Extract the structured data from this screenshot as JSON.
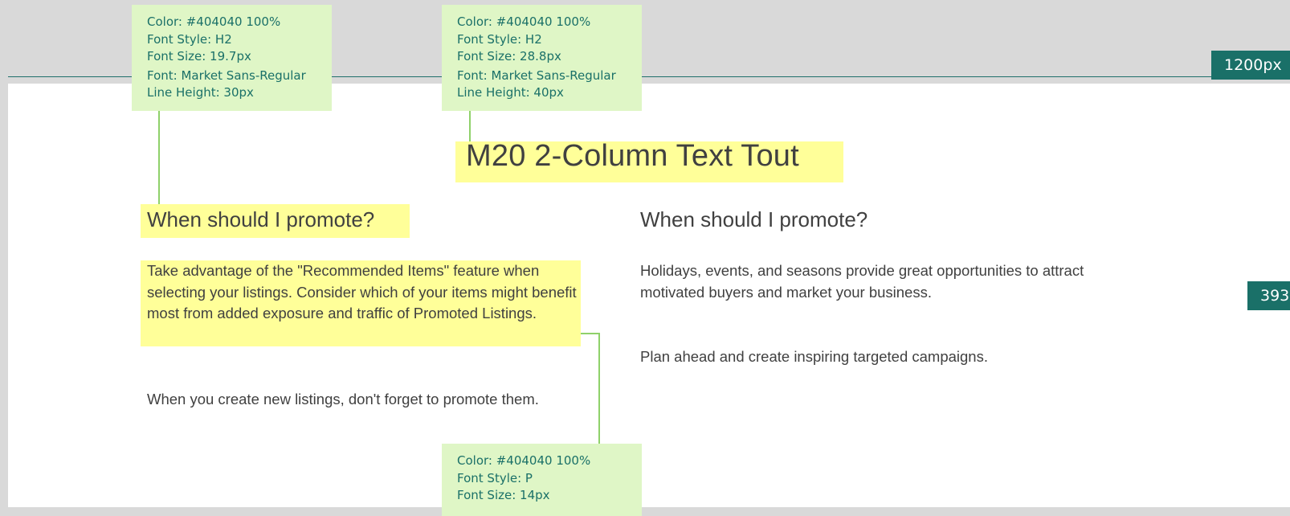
{
  "annotations": {
    "width_marker": "1200px",
    "side_marker": "393",
    "notes": [
      {
        "lines": [
          "Color: #404040 100%",
          "Font Style: H2",
          "Font Size: 19.7px",
          "Font: Market Sans-Regular",
          "Line Height: 30px"
        ]
      },
      {
        "lines": [
          "Color: #404040 100%",
          "Font Style: H2",
          "Font Size: 28.8px",
          "Font: Market Sans-Regular",
          "Line Height: 40px"
        ]
      },
      {
        "lines": [
          "Color: #404040 100%",
          "Font Style: P",
          "Font Size: 14px"
        ]
      }
    ]
  },
  "module": {
    "title": "M20 2-Column Text Tout",
    "left_column": {
      "heading": "When should I promote?",
      "paragraph_1": "Take advantage of the \"Recommended Items\" feature when selecting your listings. Consider which of your items might benefit most from added exposure and traffic of Promoted Listings.",
      "paragraph_2": "When you create new listings, don't forget to promote them."
    },
    "right_column": {
      "heading": "When should I promote?",
      "paragraph_1": "Holidays, events, and seasons provide great opportunities to attract motivated buyers and market your business.",
      "paragraph_2": "Plan ahead and create inspiring targeted campaigns."
    }
  },
  "colors": {
    "text": "#404040",
    "highlight": "#ffff99",
    "note_bg": "#dff6c6",
    "note_text": "#1a7068",
    "connector": "#8fd16a",
    "badge_bg": "#1a7068"
  }
}
